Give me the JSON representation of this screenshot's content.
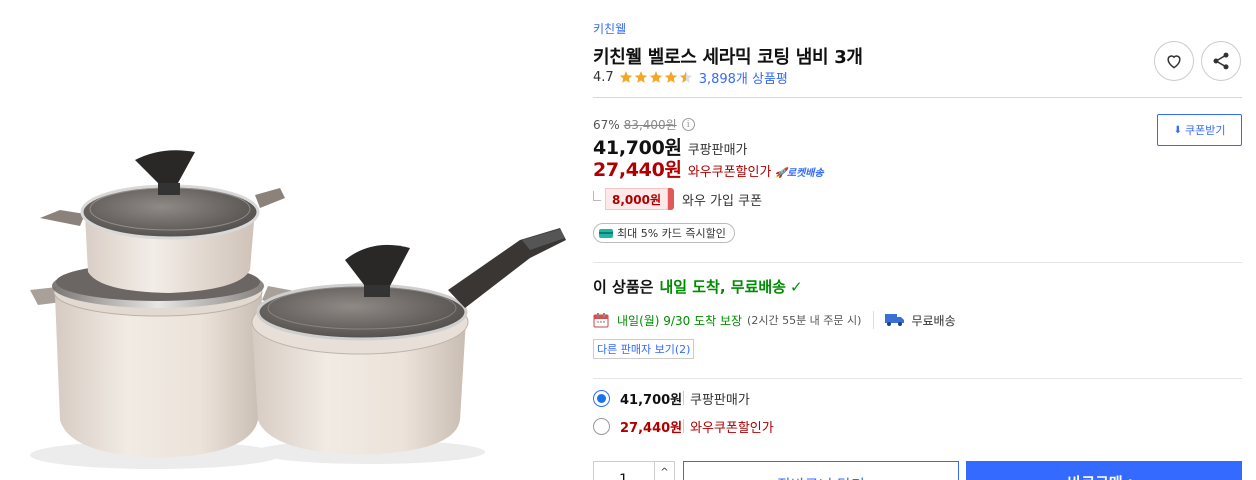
{
  "product": {
    "brand": "키친웰",
    "title": "키친웰 벨로스 세라믹 코팅 냄비 3개",
    "rating": "4.7",
    "review_count": "3,898개 상품평",
    "stars": 4.5,
    "image_alt": "ceramic-pot-set"
  },
  "actions": {
    "heart_icon": "heart-icon",
    "share_icon": "share-icon"
  },
  "pricing": {
    "discount_rate": "67%",
    "original_price": "83,400원",
    "coupon_button": "쿠폰받기",
    "sale_price": "41,700원",
    "sale_label": "쿠팡판매가",
    "wow_price": "27,440원",
    "wow_label": "와우쿠폰할인가",
    "rocket_badge": "로켓배송",
    "wow_coupon_amount": "8,000원",
    "wow_coupon_label": "와우 가입 쿠폰",
    "card_discount": "최대 5% 카드 즉시할인"
  },
  "delivery": {
    "headline_prefix": "이 상품은",
    "headline_green": "내일 도착, 무료배송",
    "date_text": "내일(월) 9/30 도착 보장",
    "condition": "(2시간 55분 내 주문 시)",
    "shipping": "무료배송",
    "other_sellers": "다른 판매자 보기(2)"
  },
  "options": [
    {
      "price": "41,700원",
      "label": "쿠팡판매가",
      "selected": true
    },
    {
      "price": "27,440원",
      "label": "와우쿠폰할인가",
      "selected": false
    }
  ],
  "purchase": {
    "quantity": "1",
    "cart_label": "장바구니 담기",
    "buy_label": "바로구매 >"
  },
  "colors": {
    "accent": "#346aff",
    "price_red": "#ae0000",
    "delivery_green": "#008c00"
  }
}
